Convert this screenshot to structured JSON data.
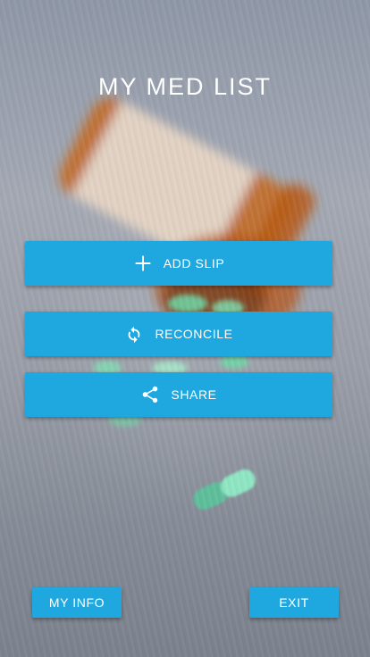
{
  "header": {
    "title": "MY MED LIST"
  },
  "actions": {
    "add_slip": {
      "label": "ADD SLIP",
      "icon": "plus-icon"
    },
    "reconcile": {
      "label": "RECONCILE",
      "icon": "refresh-icon"
    },
    "share": {
      "label": "SHARE",
      "icon": "share-icon"
    }
  },
  "footer": {
    "my_info_label": "MY INFO",
    "exit_label": "EXIT"
  },
  "colors": {
    "accent": "#1fa8e0",
    "text": "#ffffff"
  }
}
